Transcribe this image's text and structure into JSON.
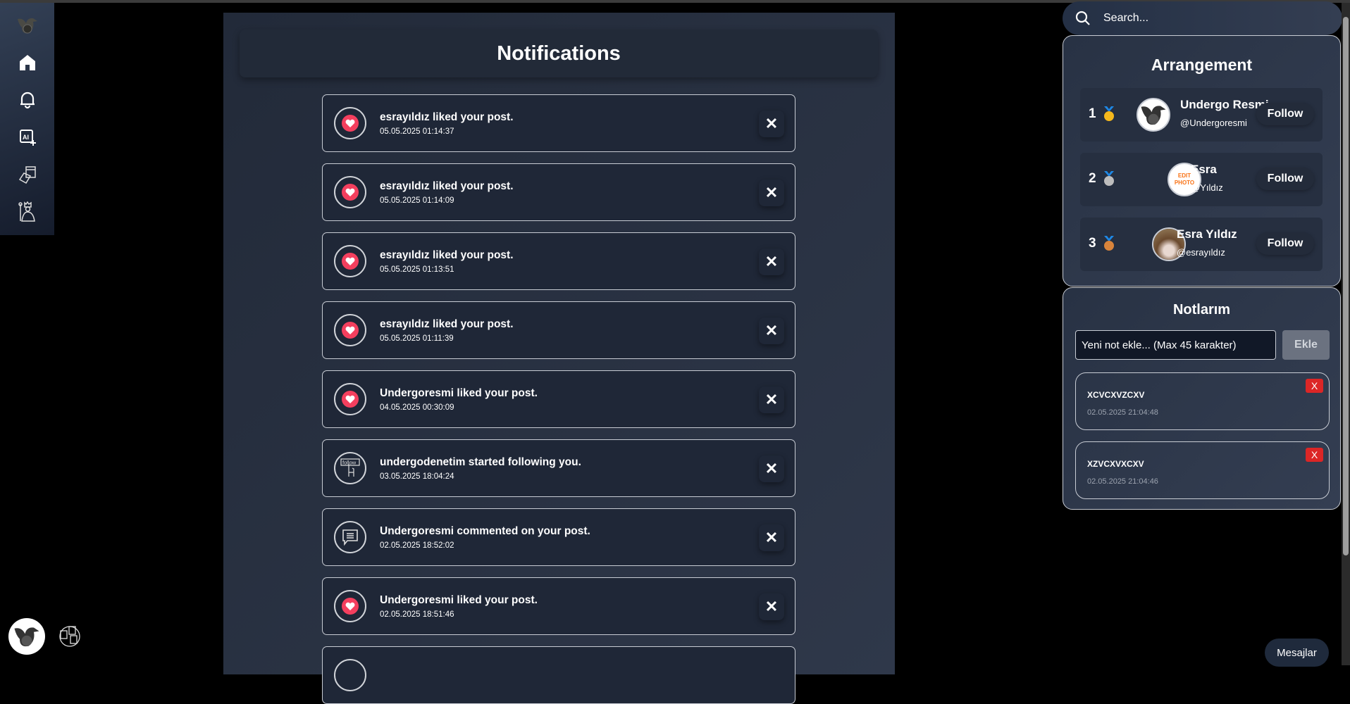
{
  "sidebar": {
    "items": [
      {
        "icon": "logo-bird-icon"
      },
      {
        "icon": "home-icon"
      },
      {
        "icon": "bell-icon"
      },
      {
        "icon": "ai-sparkle-icon"
      },
      {
        "icon": "calendar-icon"
      },
      {
        "icon": "king-icon"
      }
    ]
  },
  "main": {
    "title": "Notifications",
    "notifications": [
      {
        "type": "like",
        "message": "esrayıldız liked your post.",
        "time": "05.05.2025 01:14:37"
      },
      {
        "type": "like",
        "message": "esrayıldız liked your post.",
        "time": "05.05.2025 01:14:09"
      },
      {
        "type": "like",
        "message": "esrayıldız liked your post.",
        "time": "05.05.2025 01:13:51"
      },
      {
        "type": "like",
        "message": "esrayıldız liked your post.",
        "time": "05.05.2025 01:11:39"
      },
      {
        "type": "like",
        "message": "Undergoresmi liked your post.",
        "time": "04.05.2025 00:30:09"
      },
      {
        "type": "follow",
        "message": "undergodenetim started following you.",
        "time": "03.05.2025 18:04:24"
      },
      {
        "type": "comment",
        "message": "Undergoresmi commented on your post.",
        "time": "02.05.2025 18:52:02"
      },
      {
        "type": "like",
        "message": "Undergoresmi liked your post.",
        "time": "02.05.2025 18:51:46"
      }
    ],
    "close_label": "✕",
    "follow_icon_text": "follow"
  },
  "search": {
    "placeholder": "Search..."
  },
  "arrangement": {
    "title": "Arrangement",
    "follow_label": "Follow",
    "users": [
      {
        "rank": "1",
        "name": "Undergo Resmi",
        "handle": "@Undergoresmi",
        "medal_color": "#f5b81c"
      },
      {
        "rank": "2",
        "name": "Esra",
        "handle": "@Yıldız",
        "medal_color": "#bdbdbd",
        "avatar_text": "EDIT PHOTO"
      },
      {
        "rank": "3",
        "name": "Esra Yıldız",
        "handle": "@esrayıldız",
        "medal_color": "#d9843b"
      }
    ]
  },
  "notes": {
    "title": "Notlarım",
    "placeholder": "Yeni not ekle... (Max 45 karakter)",
    "add_label": "Ekle",
    "delete_label": "X",
    "items": [
      {
        "text": "XCVCXVZCXV",
        "date": "02.05.2025 21:04:48"
      },
      {
        "text": "XZVCXVXCXV",
        "date": "02.05.2025 21:04:46"
      }
    ]
  },
  "messages_label": "Mesajlar",
  "colors": {
    "heart": "#f43f5e",
    "delete": "#dc2626",
    "panel": "#232b3a"
  }
}
